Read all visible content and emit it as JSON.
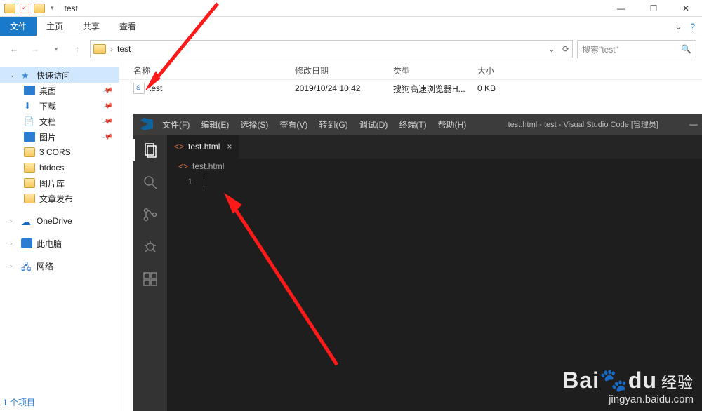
{
  "window": {
    "title": "test"
  },
  "ribbon": {
    "file": "文件",
    "home": "主页",
    "share": "共享",
    "view": "查看"
  },
  "addr": {
    "crumb": "test",
    "search_placeholder": "搜索\"test\""
  },
  "sidebar": {
    "quick": "快速访问",
    "desktop": "桌面",
    "downloads": "下载",
    "documents": "文档",
    "pictures": "图片",
    "folders": [
      "3 CORS",
      "htdocs",
      "图片库",
      "文章发布"
    ],
    "onedrive": "OneDrive",
    "thispc": "此电脑",
    "network": "网络"
  },
  "columns": {
    "name": "名称",
    "date": "修改日期",
    "type": "类型",
    "size": "大小"
  },
  "file": {
    "name": "test",
    "date": "2019/10/24 10:42",
    "type": "搜狗高速浏览器H...",
    "size": "0 KB"
  },
  "status": "1 个项目",
  "vscode": {
    "menus": [
      "文件(F)",
      "编辑(E)",
      "选择(S)",
      "查看(V)",
      "转到(G)",
      "调试(D)",
      "终端(T)",
      "帮助(H)"
    ],
    "title": "test.html - test - Visual Studio Code [管理员]",
    "tab": "test.html",
    "crumb": "test.html",
    "line": "1"
  },
  "watermark": {
    "brand_a": "Bai",
    "brand_b": "du",
    "brand_c": "经验",
    "sub": "jingyan.baidu.com"
  }
}
